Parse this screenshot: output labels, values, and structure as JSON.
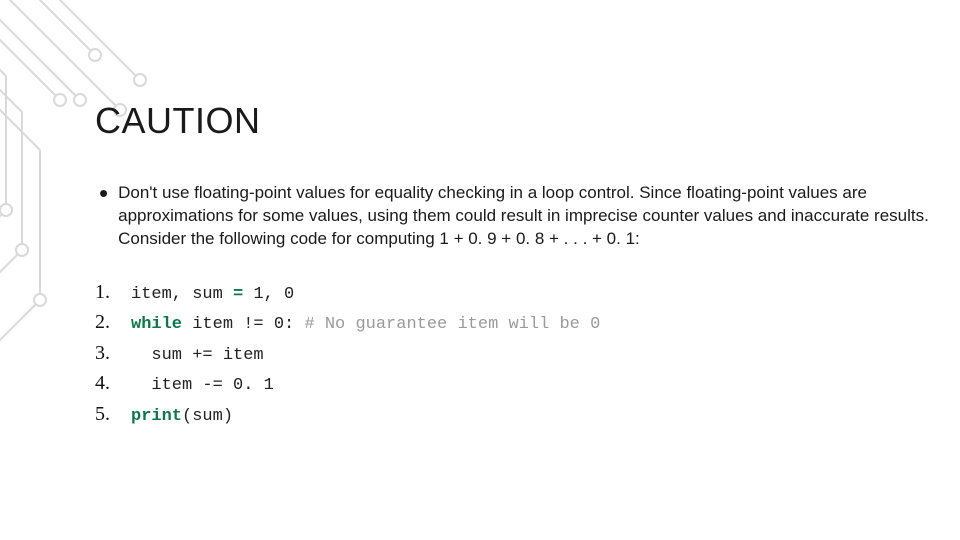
{
  "title": "CAUTION",
  "bullet": "•",
  "paragraph": "Don't use floating-point values for equality checking in a loop control. Since floating-point values are approximations for some values, using them could result in imprecise counter values and inaccurate results. Consider the following code for computing 1 + 0. 9 + 0. 8 + . . . + 0. 1:",
  "lines": [
    {
      "n": "1.",
      "pre": "item, sum ",
      "op": "= ",
      "rest": "1, 0"
    },
    {
      "n": "2.",
      "kw": "while ",
      "rest": "item != 0: ",
      "comment": "# No guarantee item will be 0"
    },
    {
      "n": "3.",
      "indent": "  ",
      "rest": "sum += item"
    },
    {
      "n": "4.",
      "indent": "  ",
      "rest": "item -= 0. 1"
    },
    {
      "n": "5.",
      "kw": "print",
      "rest": "(sum)"
    }
  ]
}
